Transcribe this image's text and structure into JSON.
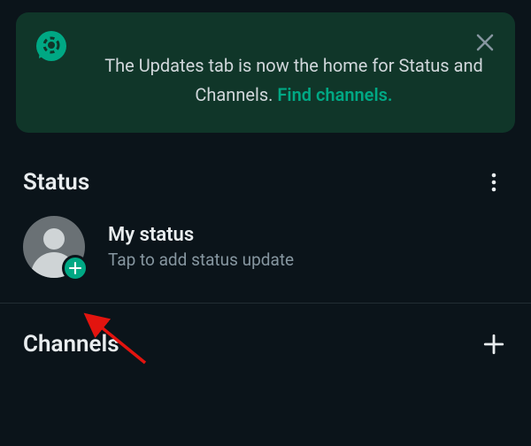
{
  "banner": {
    "text_1": "The Updates tab is now the home for Status and Channels. ",
    "link_text": "Find channels.",
    "icon": "status-speech-icon"
  },
  "sections": {
    "status_title": "Status",
    "channels_title": "Channels"
  },
  "my_status": {
    "title": "My status",
    "subtitle": "Tap to add status update"
  },
  "colors": {
    "accent": "#00a884",
    "banner_bg": "#103629",
    "bg": "#0b141a"
  }
}
